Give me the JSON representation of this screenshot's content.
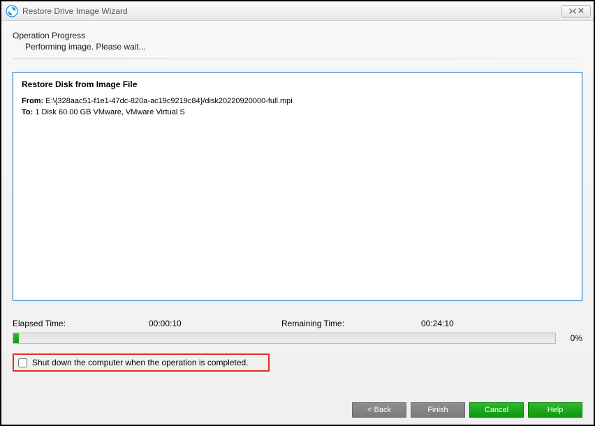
{
  "window": {
    "title": "Restore Drive Image Wizard"
  },
  "header": {
    "heading": "Operation Progress",
    "subheading": "Performing image. Please wait..."
  },
  "panel": {
    "title": "Restore Disk from Image File",
    "from_label": "From:",
    "from_value": "E:\\{328aac51-f1e1-47dc-820a-ac19c9219c84}/disk20220920000-full.mpi",
    "to_label": "To:",
    "to_value": "1 Disk 60.00 GB VMware, VMware Virtual S"
  },
  "progress": {
    "elapsed_label": "Elapsed Time:",
    "elapsed_value": "00:00:10",
    "remaining_label": "Remaining Time:",
    "remaining_value": "00:24:10",
    "percent_text": "0%",
    "percent_css_width": "1%"
  },
  "shutdown": {
    "label": "Shut down the computer when the operation is completed."
  },
  "buttons": {
    "back": "< Back",
    "finish": "Finish",
    "cancel": "Cancel",
    "help": "Help"
  }
}
